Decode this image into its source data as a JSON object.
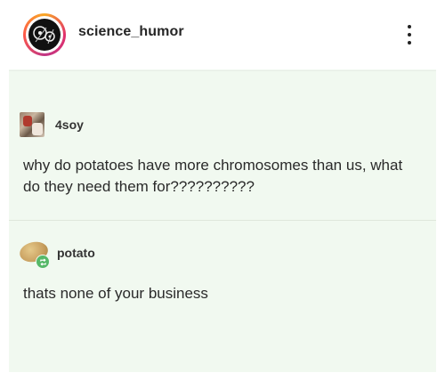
{
  "header": {
    "username": "science_humor",
    "more_icon": "more-vertical-icon"
  },
  "post": {
    "original": {
      "author": "4soy",
      "text": "why do potatoes have more chromosomes than us, what do they need them for??????????"
    },
    "reply": {
      "author": "potato",
      "text": "thats none of your business"
    }
  },
  "colors": {
    "post_background": "#f1f9f0",
    "avatar_ring": "#e1306c",
    "reblog_badge": "#56b868"
  }
}
